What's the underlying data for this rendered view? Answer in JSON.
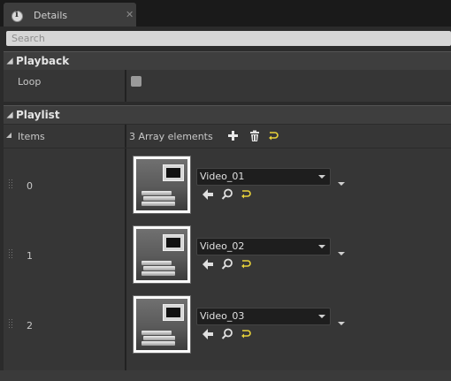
{
  "tab": {
    "title": "Details",
    "close": "✕"
  },
  "search": {
    "placeholder": "Search"
  },
  "playback": {
    "header": "Playback",
    "loop_label": "Loop",
    "loop_checked": false
  },
  "playlist": {
    "header": "Playlist",
    "items_label": "Items",
    "count_text": "3 Array elements",
    "add_icon": "plus-icon",
    "delete_icon": "trash-icon",
    "reset_icon": "reset-arrow-icon",
    "entries": [
      {
        "index": "0",
        "value": "Video_01"
      },
      {
        "index": "1",
        "value": "Video_02"
      },
      {
        "index": "2",
        "value": "Video_03"
      }
    ]
  },
  "colors": {
    "accent_yellow": "#e8d23a",
    "panel": "#2b2b2b",
    "row": "#363636"
  }
}
